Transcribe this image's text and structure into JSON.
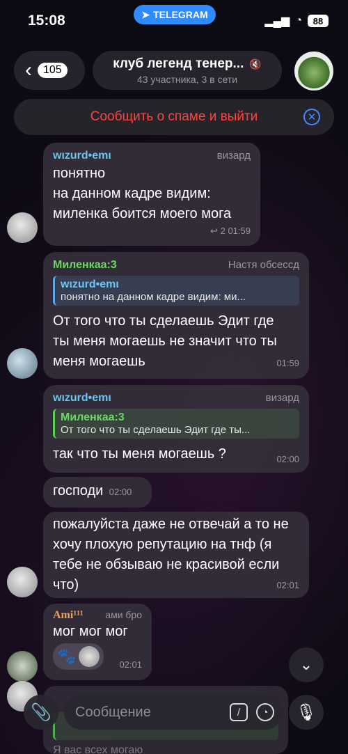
{
  "status": {
    "time": "15:08",
    "telegram_label": "TELEGRAM",
    "battery": "88"
  },
  "header": {
    "back_count": "105",
    "title": "клуб легенд тенер...",
    "subtitle": "43 участника, 3 в сети"
  },
  "spam_bar": {
    "label": "Сообщить о спаме и выйти"
  },
  "messages": [
    {
      "sender": "wιzurd•emι",
      "role": "визард",
      "text": "понятно\nна данном кадре видим:\nмиленка боится моего мога",
      "replies_count": "2",
      "time": "01:59"
    },
    {
      "sender": "Миленкаа:3",
      "role": "Настя обсесcд",
      "reply_name": "wιzurd•emι",
      "reply_text": "понятно на данном кадре видим: ми...",
      "text": "От того что ты сделаешь Эдит где ты меня могаешь не значит что ты меня могаешь",
      "time": "01:59"
    },
    {
      "sender": "wιzurd•emι",
      "role": "визард",
      "reply_name": "Миленкаа:3",
      "reply_text": "От того что ты сделаешь Эдит где ты...",
      "text": "так что ты меня могаешь ?",
      "time": "02:00"
    },
    {
      "text": "господи",
      "time": "02:00"
    },
    {
      "text": "пожалуйста даже не отвечай а то не хочу плохую репутацию на тнф (я тебе не обзываю не красивой если что)",
      "time": "02:01"
    },
    {
      "sender": "Ami¹¹¹",
      "role": "ами бро",
      "text": "мог мог мог",
      "time": "02:01"
    }
  ],
  "partial_message": {
    "text": "Я вас всех могаю"
  },
  "input": {
    "placeholder": "Сообщение"
  },
  "colors": {
    "accent": "#2f8cff",
    "spam_red": "#ff453a",
    "bubble": "#342e3a"
  },
  "icons": [
    "signal-icon",
    "wifi-icon",
    "mute-icon",
    "close-icon",
    "reply-icon",
    "paw-icon",
    "chevron-down-icon",
    "paperclip-icon",
    "command-icon",
    "sticker-icon",
    "microphone-icon"
  ]
}
